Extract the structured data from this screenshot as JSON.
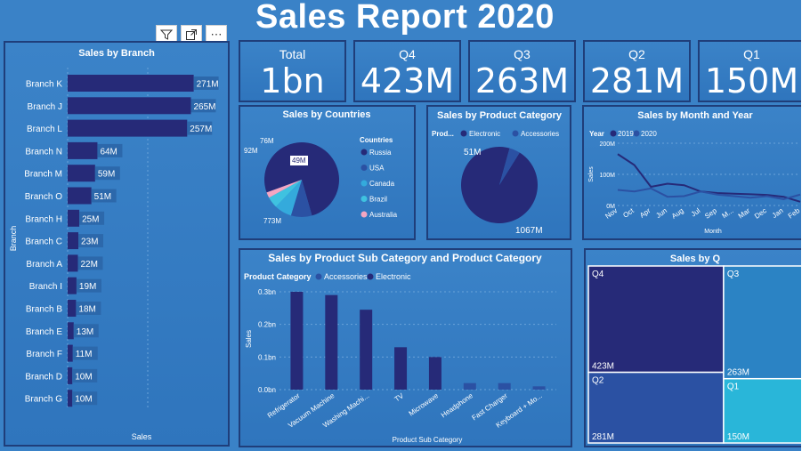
{
  "title": "Sales Report 2020",
  "toolbar": {
    "filter_icon": "filter-icon",
    "focus_icon": "focus-mode-icon",
    "more_icon": "more-options-icon",
    "more_label": "⋯"
  },
  "kpis": [
    {
      "label": "Total",
      "value": "1bn"
    },
    {
      "label": "Q4",
      "value": "423M"
    },
    {
      "label": "Q3",
      "value": "263M"
    },
    {
      "label": "Q2",
      "value": "281M"
    },
    {
      "label": "Q1",
      "value": "150M"
    }
  ],
  "colors": {
    "navy": "#262a78",
    "mid": "#2b51a3",
    "light": "#34aadc",
    "pink": "#f4a6c2",
    "cyan": "#29b6d9"
  },
  "chart_data": [
    {
      "id": "branch",
      "type": "bar",
      "orientation": "horizontal",
      "title": "Sales by Branch",
      "xlabel": "Sales",
      "ylabel": "Branch",
      "categories": [
        "Branch K",
        "Branch J",
        "Branch L",
        "Branch N",
        "Branch M",
        "Branch O",
        "Branch H",
        "Branch C",
        "Branch A",
        "Branch I",
        "Branch B",
        "Branch E",
        "Branch F",
        "Branch D",
        "Branch G"
      ],
      "values": [
        271,
        265,
        257,
        64,
        59,
        51,
        25,
        23,
        22,
        19,
        18,
        13,
        11,
        10,
        10
      ],
      "labels": [
        "271M",
        "265M",
        "257M",
        "64M",
        "59M",
        "51M",
        "25M",
        "23M",
        "22M",
        "19M",
        "18M",
        "13M",
        "11M",
        "10M",
        "10M"
      ],
      "xlim": [
        0,
        310
      ]
    },
    {
      "id": "countries",
      "type": "pie",
      "title": "Sales by Countries",
      "legend_title": "Countries",
      "legend": "right",
      "categories": [
        "Russia",
        "USA",
        "Canada",
        "Brazil",
        "Australia"
      ],
      "values": [
        773,
        92,
        76,
        49,
        25
      ],
      "slice_labels": [
        "773M",
        "92M",
        "76M",
        "49M",
        ""
      ],
      "colors": [
        "#262a78",
        "#2b51a3",
        "#34aadc",
        "#3fc2e0",
        "#f4a6c2"
      ]
    },
    {
      "id": "category",
      "type": "pie",
      "title": "Sales by Product Category",
      "legend_title": "Prod...",
      "legend": "top",
      "categories": [
        "Electronic",
        "Accessories"
      ],
      "values": [
        1067,
        51
      ],
      "slice_labels": [
        "1067M",
        "51M"
      ],
      "colors": [
        "#262a78",
        "#2b51a3"
      ]
    },
    {
      "id": "month",
      "type": "line",
      "title": "Sales by Month and Year",
      "legend_title": "Year",
      "xlabel": "Month",
      "ylabel": "Sales",
      "categories": [
        "Nov",
        "Oct",
        "Apr",
        "Jun",
        "Aug",
        "Jul",
        "Sep",
        "M...",
        "Mar",
        "Dec",
        "Jan",
        "Feb"
      ],
      "yticks": [
        "0M",
        "100M",
        "200M"
      ],
      "ylim": [
        0,
        200
      ],
      "series": [
        {
          "name": "2019",
          "values": [
            165,
            130,
            60,
            70,
            65,
            45,
            40,
            38,
            36,
            34,
            28,
            12
          ],
          "color": "#262a78"
        },
        {
          "name": "2020",
          "values": [
            50,
            45,
            55,
            28,
            30,
            45,
            35,
            30,
            25,
            30,
            20,
            35
          ],
          "color": "#2b51a3"
        }
      ]
    },
    {
      "id": "subcategory",
      "type": "bar",
      "title": "Sales by Product Sub Category and Product Category",
      "legend_title": "Product Category",
      "xlabel": "Product Sub Category",
      "ylabel": "Sales",
      "categories": [
        "Refrigerator",
        "Vacuum Machine",
        "Washing Machi...",
        "TV",
        "Microwave",
        "Headphone",
        "Fast Charger",
        "Keyboard + Mo..."
      ],
      "yticks": [
        "0.0bn",
        "0.1bn",
        "0.2bn",
        "0.3bn"
      ],
      "ylim": [
        0,
        0.3
      ],
      "series": [
        {
          "name": "Accessories",
          "values": [
            0,
            0,
            0,
            0,
            0,
            0.02,
            0.02,
            0.01
          ],
          "color": "#2b51a3"
        },
        {
          "name": "Electronic",
          "values": [
            0.3,
            0.29,
            0.245,
            0.13,
            0.1,
            0,
            0,
            0
          ],
          "color": "#262a78"
        }
      ]
    },
    {
      "id": "quarter",
      "type": "treemap",
      "title": "Sales by Q",
      "categories": [
        "Q4",
        "Q3",
        "Q2",
        "Q1"
      ],
      "values": [
        423,
        263,
        281,
        150
      ],
      "labels": [
        "423M",
        "263M",
        "281M",
        "150M"
      ],
      "colors": [
        "#262a78",
        "#2b83c4",
        "#2b51a3",
        "#29b6d9"
      ]
    }
  ]
}
